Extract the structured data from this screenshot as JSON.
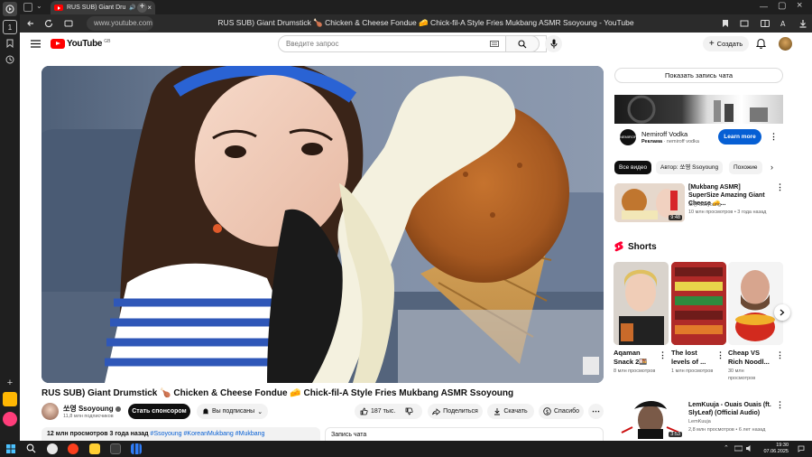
{
  "browser": {
    "tab_title": "RUS SUB) Giant Dru",
    "url": "www.youtube.com",
    "page_title": "RUS SUB) Giant Drumstick 🍗 Chicken & Cheese Fondue 🧀 Chick-fil-A Style Fries Mukbang ASMR Ssoyoung - YouTube",
    "side_badge": "1"
  },
  "header": {
    "logo_text": "YouTube",
    "region": "GB",
    "search_placeholder": "Введите запрос",
    "create_label": "Создать"
  },
  "video": {
    "title": "RUS SUB) Giant Drumstick 🍗 Chicken & Cheese Fondue 🧀 Chick-fil-A Style Fries Mukbang ASMR Ssoyoung",
    "channel_name": "쏘영 Ssoyoung",
    "subscribers": "11,8 млн подписчиков",
    "sponsor_label": "Стать спонсором",
    "subscribed_label": "Вы подписаны",
    "likes": "187 тыс.",
    "share_label": "Поделиться",
    "download_label": "Скачать",
    "thanks_label": "Спасибо",
    "views_date": "12 млн просмотров  3 года назад",
    "tags": "#Ssoyoung #KoreanMukbang #Mukbang",
    "chat_label": "Запись чата"
  },
  "sidebar": {
    "show_chat": "Показать запись чата",
    "ad": {
      "name": "Nemiroff Vodka",
      "sub_label": "Реклама",
      "sub_name": "nemiroff vodka",
      "cta": "Learn more"
    },
    "chips": [
      "Все видео",
      "Автор: 쏘영 Ssoyoung",
      "Похожие"
    ],
    "rec": {
      "title": "[Mukbang ASMR] SuperSize Amazing Giant Cheese 🧀...",
      "channel": "쏘영 Ssoyoung",
      "meta": "10 млн просмотров  •  3 года назад",
      "duration": "9:48"
    },
    "shorts_title": "Shorts",
    "shorts": [
      {
        "title": "Aqaman Snack 2🍱",
        "views": "8 млн просмотров"
      },
      {
        "title": "The lost levels of ...",
        "views": "1 млн просмотров"
      },
      {
        "title": "Cheap VS Rich Noodl...",
        "views": "30 млн просмотров"
      }
    ],
    "lem": {
      "title": "LemKuuja - Ouais Ouais (ft. SlyLeaf) (Official Audio)",
      "channel": "LemKuuja",
      "meta": "2,8 млн просмотров  •  6 лет назад",
      "duration": "3:53"
    }
  },
  "taskbar": {
    "time": "19:30",
    "date": "07.06.2025"
  }
}
